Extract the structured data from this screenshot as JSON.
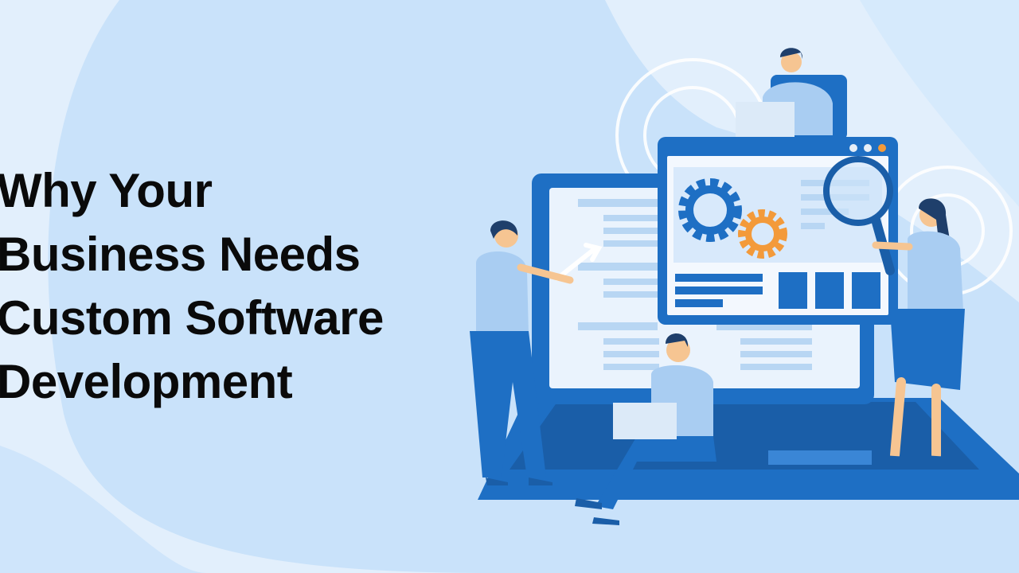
{
  "headline": {
    "lines": [
      "Why Your",
      "Business Needs",
      "Custom Software",
      "Development"
    ]
  },
  "illustration": {
    "scene": "laptop-with-dashboard-and-team",
    "icons": [
      "gear-icon",
      "magnifier-icon",
      "cursor-arrow-icon"
    ]
  },
  "colors": {
    "background": "#dcecfb",
    "blob": "#c8e2fa",
    "primary_blue": "#1e6fc4",
    "dark_blue": "#1a5ea8",
    "light_blue": "#b8d6f3",
    "orange": "#f39a3a",
    "text": "#0a0a0a"
  }
}
